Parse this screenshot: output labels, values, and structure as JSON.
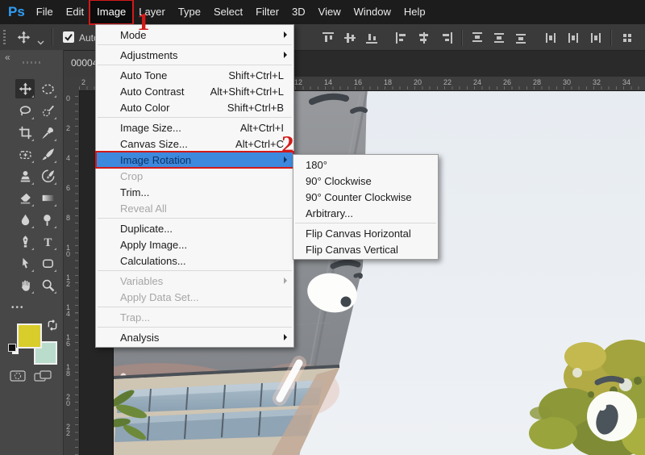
{
  "menubar": {
    "logo_text": "Ps",
    "items": [
      {
        "label": "File"
      },
      {
        "label": "Edit"
      },
      {
        "label": "Image",
        "annotated": true
      },
      {
        "label": "Layer"
      },
      {
        "label": "Type"
      },
      {
        "label": "Select"
      },
      {
        "label": "Filter"
      },
      {
        "label": "3D"
      },
      {
        "label": "View"
      },
      {
        "label": "Window"
      },
      {
        "label": "Help"
      }
    ]
  },
  "options_bar": {
    "tool_icon": "move-icon",
    "auto_select_label": "Auto-S",
    "auto_select_checked": true,
    "align_icons": [
      "align-top",
      "align-vcenter",
      "align-bottom",
      "align-left",
      "align-hcenter",
      "align-right",
      "dist-top",
      "dist-vcenter",
      "dist-bottom",
      "dist-left",
      "dist-hcenter",
      "dist-right",
      "align-options"
    ]
  },
  "document_tab": {
    "title": "00004"
  },
  "toolbar": {
    "collapse_glyph": "«",
    "ellipsis_glyph": "•••",
    "tools": [
      {
        "name": "move-tool",
        "selected": true
      },
      {
        "name": "elliptical-marquee-tool"
      },
      {
        "name": "lasso-tool"
      },
      {
        "name": "quick-selection-tool"
      },
      {
        "name": "crop-tool"
      },
      {
        "name": "eyedropper-tool"
      },
      {
        "name": "spot-healing-brush-tool"
      },
      {
        "name": "brush-tool"
      },
      {
        "name": "clone-stamp-tool"
      },
      {
        "name": "history-brush-tool"
      },
      {
        "name": "eraser-tool"
      },
      {
        "name": "gradient-tool"
      },
      {
        "name": "blur-tool"
      },
      {
        "name": "dodge-tool"
      },
      {
        "name": "pen-tool"
      },
      {
        "name": "type-tool"
      },
      {
        "name": "path-selection-tool"
      },
      {
        "name": "shape-tool"
      },
      {
        "name": "hand-tool"
      },
      {
        "name": "zoom-tool"
      }
    ],
    "foreground_color": "#d8cd2b",
    "background_color": "#badccd"
  },
  "rulers": {
    "horizontal_labels": [
      "2",
      "12",
      "14",
      "16",
      "18",
      "20",
      "22",
      "24",
      "26",
      "28",
      "30",
      "32",
      "34"
    ],
    "vertical_labels": [
      "0",
      "2",
      "4",
      "6",
      "8",
      "10",
      "12",
      "14",
      "16",
      "18",
      "20",
      "22"
    ]
  },
  "image_menu": {
    "items": [
      {
        "label": "Mode",
        "submenu_arrow": true
      },
      {
        "separator": true
      },
      {
        "label": "Adjustments",
        "submenu_arrow": true
      },
      {
        "separator": true
      },
      {
        "label": "Auto Tone",
        "shortcut": "Shift+Ctrl+L"
      },
      {
        "label": "Auto Contrast",
        "shortcut": "Alt+Shift+Ctrl+L"
      },
      {
        "label": "Auto Color",
        "shortcut": "Shift+Ctrl+B"
      },
      {
        "separator": true
      },
      {
        "label": "Image Size...",
        "shortcut": "Alt+Ctrl+I"
      },
      {
        "label": "Canvas Size...",
        "shortcut": "Alt+Ctrl+C"
      },
      {
        "label": "Image Rotation",
        "submenu_arrow": true,
        "highlighted": true,
        "annotated": true
      },
      {
        "label": "Crop",
        "disabled": true
      },
      {
        "label": "Trim..."
      },
      {
        "label": "Reveal All",
        "disabled": true
      },
      {
        "separator": true
      },
      {
        "label": "Duplicate..."
      },
      {
        "label": "Apply Image..."
      },
      {
        "label": "Calculations..."
      },
      {
        "separator": true
      },
      {
        "label": "Variables",
        "disabled": true,
        "submenu_arrow": true
      },
      {
        "label": "Apply Data Set...",
        "disabled": true
      },
      {
        "separator": true
      },
      {
        "label": "Trap...",
        "disabled": true
      },
      {
        "separator": true
      },
      {
        "label": "Analysis",
        "submenu_arrow": true
      }
    ]
  },
  "rotation_submenu": {
    "items": [
      {
        "label": "180°"
      },
      {
        "label": "90° Clockwise"
      },
      {
        "label": "90° Counter Clockwise"
      },
      {
        "label": "Arbitrary..."
      },
      {
        "separator": true
      },
      {
        "label": "Flip Canvas Horizontal"
      },
      {
        "label": "Flip Canvas Vertical"
      }
    ]
  },
  "annotations": {
    "step1": "1",
    "step2": "2",
    "color": "#d21a18"
  },
  "colors": {
    "menubar_bg": "#1c1c1c",
    "panel_bg": "#474747",
    "menu_bg": "#f7f7f7",
    "menu_highlight": "#3d89dd",
    "menu_highlight_text": "#0e3264",
    "annotation_red": "#d21a18",
    "ps_logo_blue": "#2f9ef6"
  }
}
